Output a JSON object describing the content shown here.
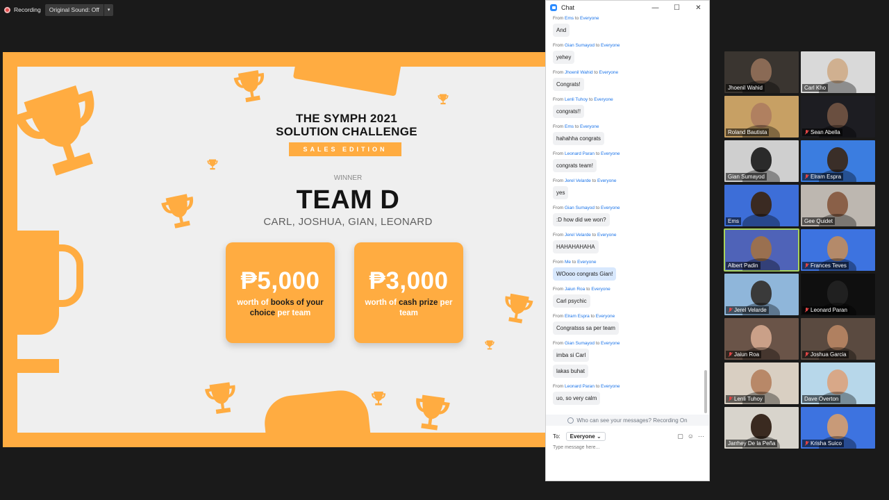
{
  "recording": {
    "label": "Recording",
    "original_sound": "Original Sound: Off",
    "caret": "▾"
  },
  "slide": {
    "title_line1": "THE SYMPH 2021",
    "title_line2": "SOLUTION CHALLENGE",
    "edition": "SALES EDITION",
    "winner_label": "WINNER",
    "team": "TEAM D",
    "members": "CARL, JOSHUA, GIAN, LEONARD",
    "card1": {
      "amount": "₱5,000",
      "pre": "worth of ",
      "bold": "books of your choice",
      "post": " per team"
    },
    "card2": {
      "amount": "₱3,000",
      "pre": "worth of ",
      "bold": "cash prize",
      "post": " per team"
    },
    "accent": "#ffac41"
  },
  "chat": {
    "title": "Chat",
    "win_minimize": "—",
    "win_maximize": "☐",
    "win_close": "✕",
    "from_label": "From",
    "to_label": "to",
    "messages": [
      {
        "name": "Ems",
        "to": "Everyone",
        "texts": [
          "And"
        ]
      },
      {
        "name": "Gian Sumayod",
        "to": "Everyone",
        "texts": [
          "yehey"
        ]
      },
      {
        "name": "Jhoenil Wahid",
        "to": "Everyone",
        "texts": [
          "Congrats!"
        ]
      },
      {
        "name": "Lenli Tuhoy",
        "to": "Everyone",
        "texts": [
          "congrats!!"
        ]
      },
      {
        "name": "Ems",
        "to": "Everyone",
        "texts": [
          "hahahha congrats"
        ]
      },
      {
        "name": "Leonard Paran",
        "to": "Everyone",
        "texts": [
          "congrats team!"
        ]
      },
      {
        "name": "Jerel Velarde",
        "to": "Everyone",
        "texts": [
          "yes"
        ]
      },
      {
        "name": "Gian Sumayod",
        "to": "Everyone",
        "texts": [
          ":D how did we won?"
        ]
      },
      {
        "name": "Jerel Velarde",
        "to": "Everyone",
        "texts": [
          "HAHAHAHAHA"
        ]
      },
      {
        "name": "Me",
        "to": "Everyone",
        "texts": [
          "WOooo congrats Gian!"
        ],
        "mine": true
      },
      {
        "name": "Jaiun Roa",
        "to": "Everyone",
        "texts": [
          "Carl psychic"
        ]
      },
      {
        "name": "Elram Espra",
        "to": "Everyone",
        "texts": [
          "Congratsss sa per team"
        ]
      },
      {
        "name": "Gian Sumayod",
        "to": "Everyone",
        "texts": [
          "imba si Carl",
          "lakas buhat"
        ]
      },
      {
        "name": "Leonard Paran",
        "to": "Everyone",
        "texts": [
          "uo, so very calm"
        ]
      }
    ],
    "privacy_notice": "Who can see your messages? Recording On",
    "to_prefix": "To:",
    "to_value": "Everyone",
    "to_caret": "⌄",
    "file_icon": "file-icon",
    "emoji_icon": "emoji-icon",
    "more_icon": "···",
    "placeholder": "Type message here..."
  },
  "participants": [
    {
      "name": "Jhoenil Wahid",
      "muted": false,
      "bg": "#3a3530",
      "skin": "#8a6a55"
    },
    {
      "name": "Carl Kho",
      "muted": false,
      "bg": "#d9d9d9",
      "skin": "#d0b090"
    },
    {
      "name": "Roland Bautista",
      "muted": false,
      "bg": "#c7a064",
      "skin": "#b08060"
    },
    {
      "name": "Sean Abella",
      "muted": true,
      "bg": "#1d1d22",
      "skin": "#6a4f40"
    },
    {
      "name": "Gian Sumayod",
      "muted": false,
      "bg": "#cfcfcf",
      "skin": "#2a2a2a"
    },
    {
      "name": "Elram Espra",
      "muted": true,
      "bg": "#3b7de0",
      "skin": "#3a2e28"
    },
    {
      "name": "Ems",
      "muted": false,
      "bg": "#3d6ed8",
      "skin": "#3a2a22"
    },
    {
      "name": "Gee Quidet",
      "muted": false,
      "bg": "#bdb7b0",
      "skin": "#8a6048"
    },
    {
      "name": "Albert Padin",
      "muted": false,
      "bg": "#4f63b8",
      "skin": "#9a7050",
      "active": true
    },
    {
      "name": "Frances Teves",
      "muted": true,
      "bg": "#3d73e0",
      "skin": "#b48a6a"
    },
    {
      "name": "Jerel Velarde",
      "muted": true,
      "bg": "#8fb6da",
      "skin": "#3a3a3a"
    },
    {
      "name": "Leonard Paran",
      "muted": true,
      "bg": "#0f0f0f",
      "skin": "#202020"
    },
    {
      "name": "Jaiun Roa",
      "muted": true,
      "bg": "#6a5448",
      "skin": "#caa088"
    },
    {
      "name": "Joshua Garcia",
      "muted": true,
      "bg": "#5a4a40",
      "skin": "#b08060"
    },
    {
      "name": "Lenli Tuhoy",
      "muted": true,
      "bg": "#d9cfc2",
      "skin": "#b88868"
    },
    {
      "name": "Dave Overton",
      "muted": false,
      "bg": "#b7d7ea",
      "skin": "#d8a888"
    },
    {
      "name": "Jarrhey De la Peña",
      "muted": false,
      "bg": "#d8d4cc",
      "skin": "#3a2a20"
    },
    {
      "name": "Krisha Suico",
      "muted": true,
      "bg": "#3d73e0",
      "skin": "#c89a78"
    }
  ]
}
